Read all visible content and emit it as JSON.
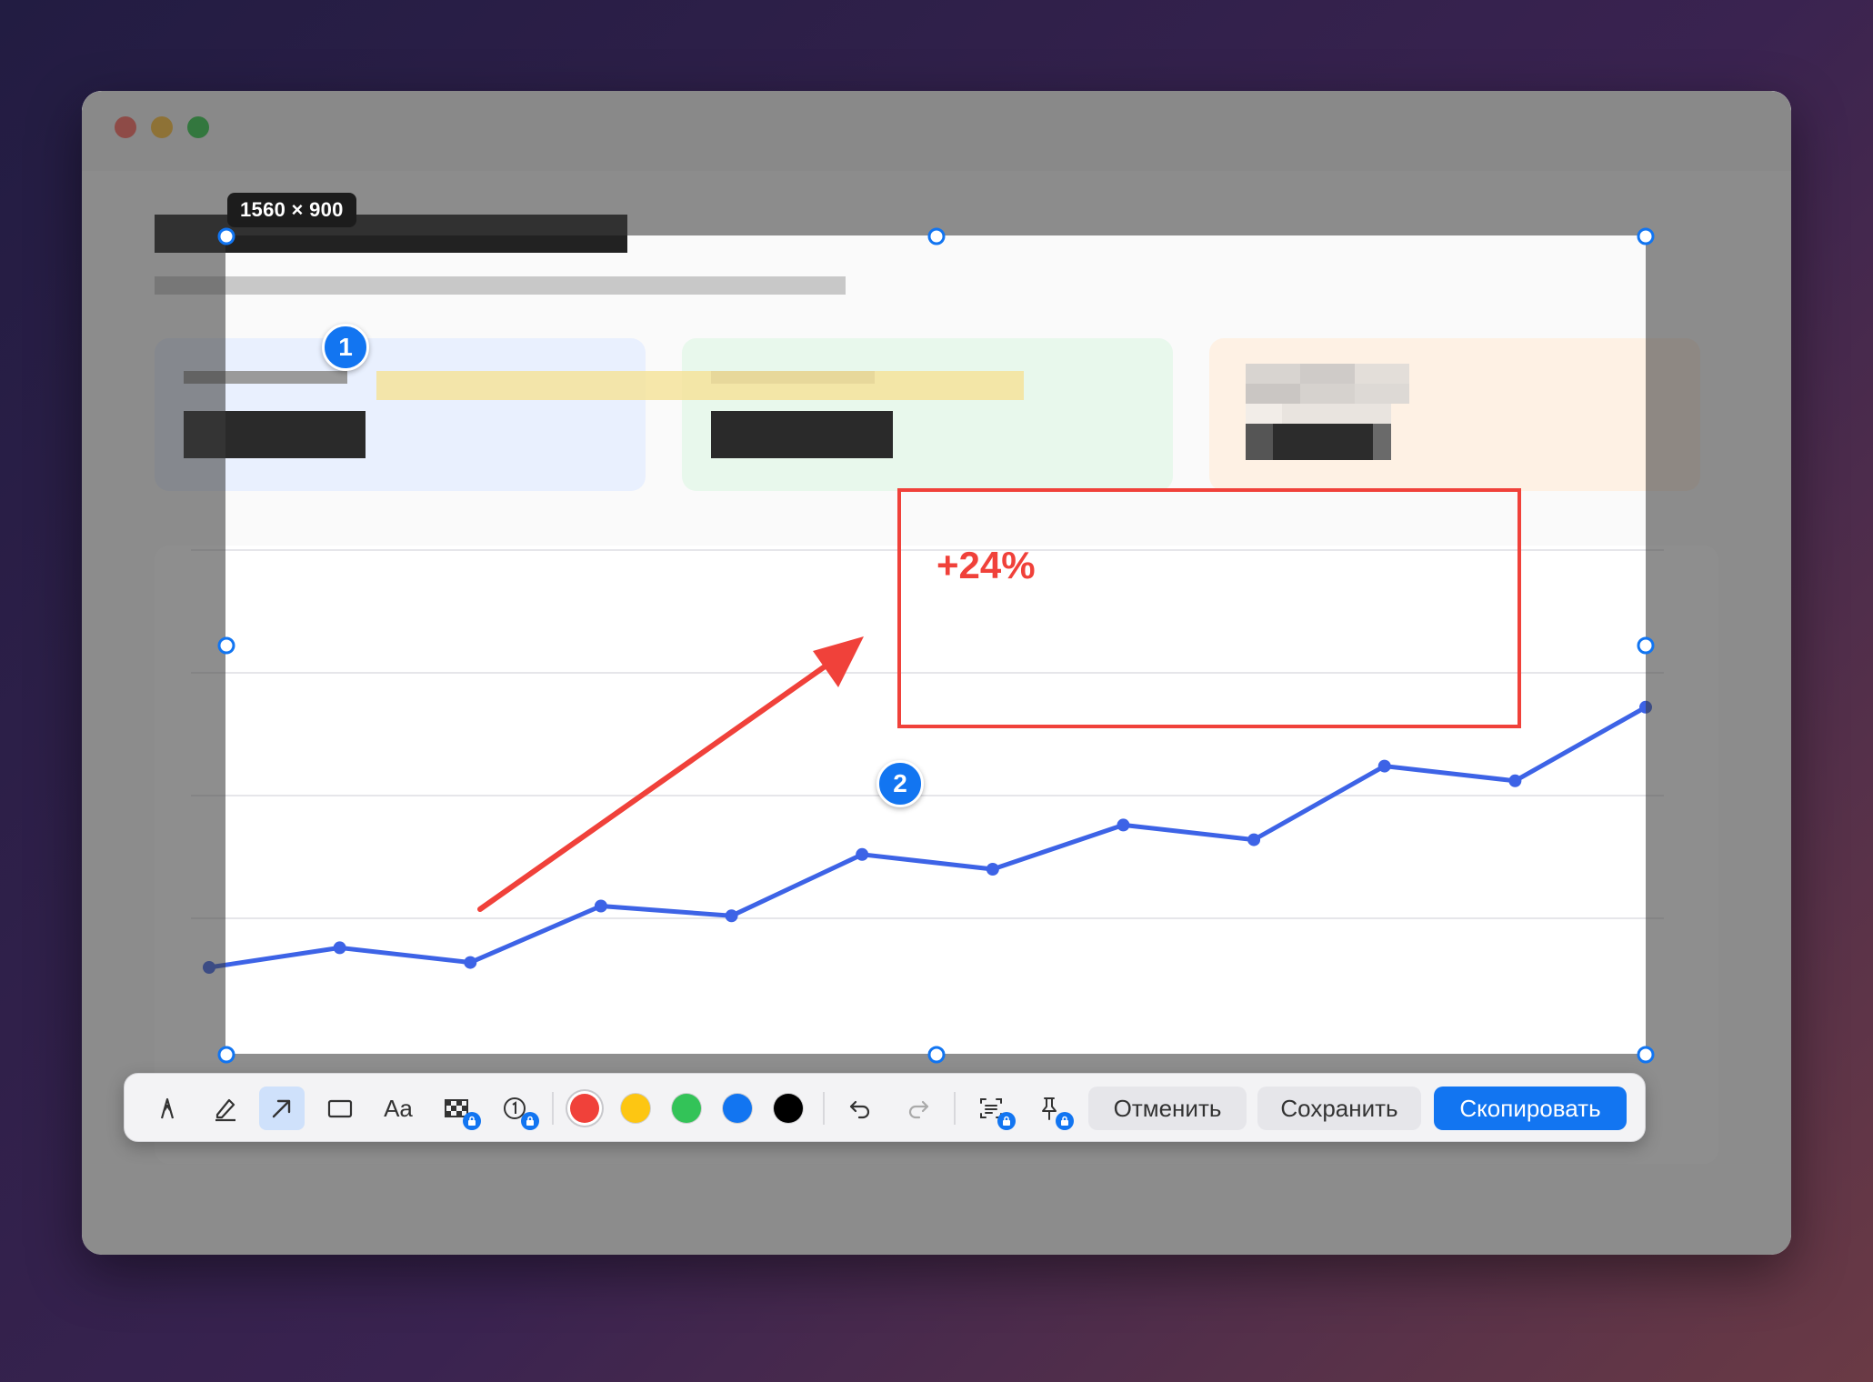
{
  "selection": {
    "size_label": "1560 × 900"
  },
  "annotations": {
    "marker_1": "1",
    "marker_2": "2",
    "callout_text": "+24%",
    "colors": {
      "red": "#f0413a",
      "blue": "#1275f1",
      "highlight": "#f5e39b"
    }
  },
  "chart_data": {
    "type": "line",
    "x": [
      1,
      2,
      3,
      4,
      5,
      6,
      7,
      8,
      9,
      10,
      11,
      12
    ],
    "series": [
      {
        "values": [
          30,
          38,
          32,
          55,
          51,
          76,
          70,
          88,
          82,
          112,
          106,
          136
        ],
        "color": "#3d63e6"
      }
    ],
    "ylim": [
      0,
      200
    ],
    "grid": true
  },
  "toolbar": {
    "tools": [
      {
        "id": "pen",
        "icon": "pen-icon",
        "active": false,
        "locked": false
      },
      {
        "id": "marker",
        "icon": "highlighter-icon",
        "active": false,
        "locked": false
      },
      {
        "id": "arrow",
        "icon": "arrow-icon",
        "active": true,
        "locked": false
      },
      {
        "id": "rect",
        "icon": "rectangle-icon",
        "active": false,
        "locked": false
      },
      {
        "id": "text",
        "icon": "text-icon",
        "label": "Aa",
        "active": false,
        "locked": false
      },
      {
        "id": "pixelate",
        "icon": "pixelate-icon",
        "active": false,
        "locked": true
      },
      {
        "id": "counter",
        "icon": "counter-icon",
        "active": false,
        "locked": true
      }
    ],
    "colors": [
      "#f0413a",
      "#fdc612",
      "#33c358",
      "#1275f1",
      "#000000"
    ],
    "selected_color": "#f0413a",
    "cancel_label": "Отменить",
    "save_label": "Сохранить",
    "copy_label": "Скопировать"
  }
}
